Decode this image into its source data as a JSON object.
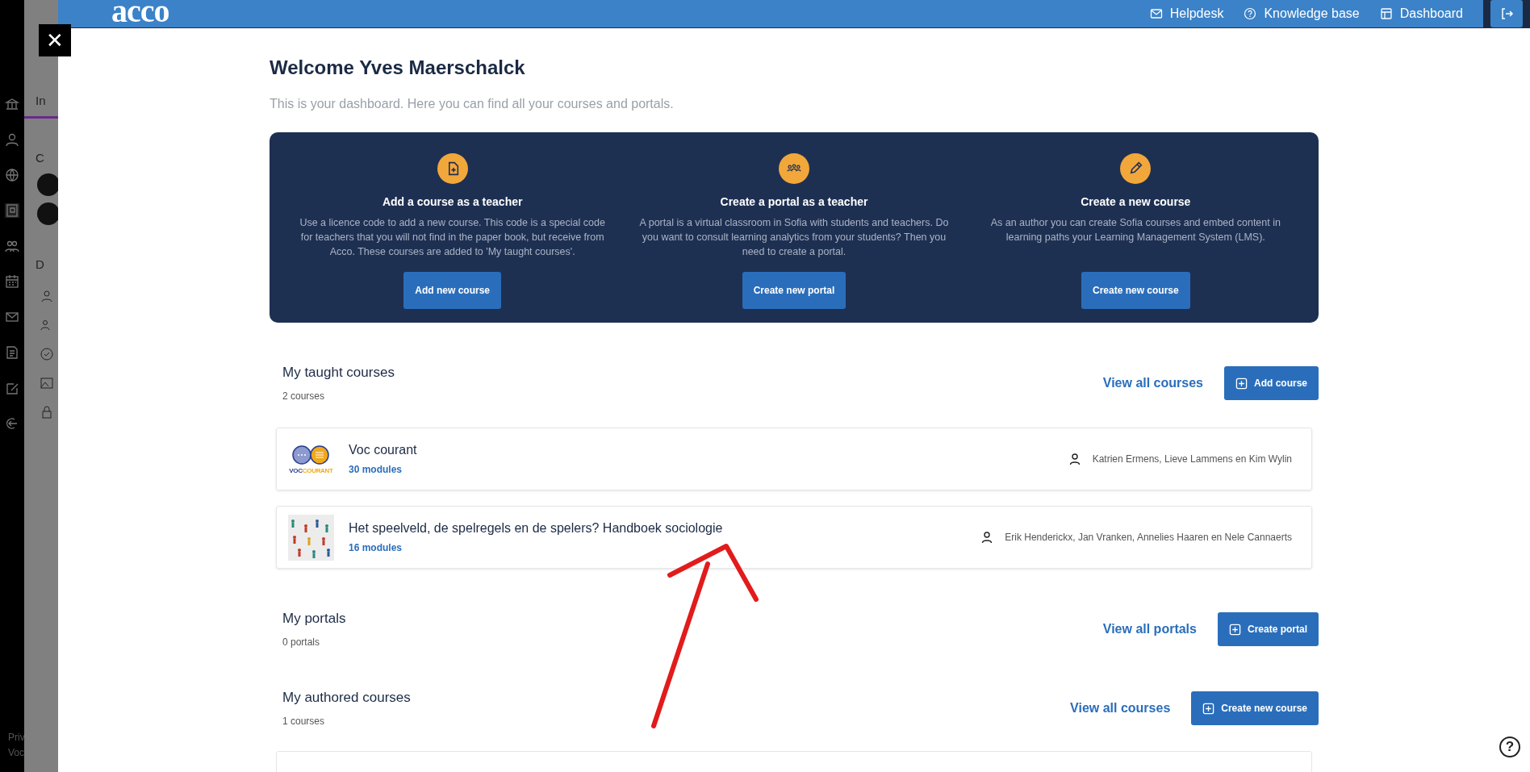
{
  "background_app": {
    "fragments": [
      "In",
      "C",
      "D"
    ],
    "footer_lines": [
      "Priv",
      "Voc"
    ]
  },
  "close_button": {
    "label": "✕"
  },
  "header": {
    "logo": "acco",
    "links": [
      {
        "label": "Helpdesk"
      },
      {
        "label": "Knowledge base"
      },
      {
        "label": "Dashboard"
      }
    ]
  },
  "welcome": {
    "title": "Welcome Yves Maerschalck",
    "subtitle": "This is your dashboard. Here you can find all your courses and portals."
  },
  "actions": [
    {
      "title": "Add a course as a teacher",
      "description": "Use a licence code to add a new course. This code is a special code for teachers that you will not find in the paper book, but receive from Acco. These courses are added to 'My taught courses'.",
      "button": "Add new course"
    },
    {
      "title": "Create a portal as a teacher",
      "description": "A portal is a virtual classroom in Sofia with students and teachers. Do you want to consult learning analytics from your students? Then you need to create a portal.",
      "button": "Create new portal"
    },
    {
      "title": "Create a new course",
      "description": "As an author you can create Sofia courses and embed content in learning paths your Learning Management System (LMS).",
      "button": "Create new course"
    }
  ],
  "sections": [
    {
      "title": "My taught courses",
      "count": "2 courses",
      "link": "View all courses",
      "button": "Add course",
      "courses": [
        {
          "kind": "logo",
          "logo_text": [
            "VOC",
            "COURANT"
          ],
          "title": "Voc courant",
          "modules": "30 modules",
          "authors": "Katrien Ermens, Lieve Lammens en Kim Wylin"
        },
        {
          "kind": "image",
          "title": "Het speelveld, de spelregels en de spelers? Handboek sociologie",
          "modules": "16 modules",
          "authors": "Erik Henderickx, Jan Vranken, Annelies Haaren en Nele Cannaerts"
        }
      ]
    },
    {
      "title": "My portals",
      "count": "0 portals",
      "link": "View all portals",
      "button": "Create portal"
    },
    {
      "title": "My authored courses",
      "count": "1 courses",
      "link": "View all courses",
      "button": "Create new course"
    }
  ],
  "help_button": {
    "label": "?"
  }
}
